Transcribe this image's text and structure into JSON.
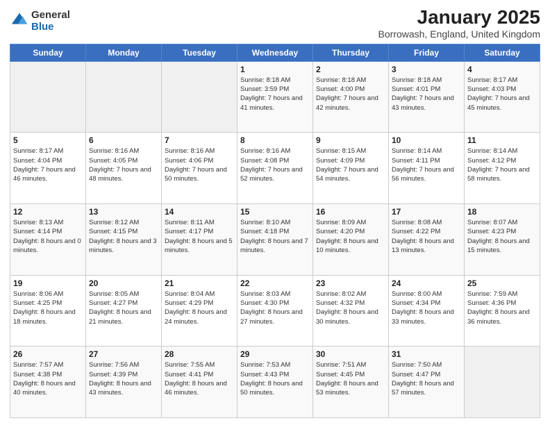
{
  "logo": {
    "general": "General",
    "blue": "Blue"
  },
  "header": {
    "title": "January 2025",
    "location": "Borrowash, England, United Kingdom"
  },
  "weekdays": [
    "Sunday",
    "Monday",
    "Tuesday",
    "Wednesday",
    "Thursday",
    "Friday",
    "Saturday"
  ],
  "weeks": [
    [
      {
        "day": "",
        "sunrise": "",
        "sunset": "",
        "daylight": ""
      },
      {
        "day": "",
        "sunrise": "",
        "sunset": "",
        "daylight": ""
      },
      {
        "day": "",
        "sunrise": "",
        "sunset": "",
        "daylight": ""
      },
      {
        "day": "1",
        "sunrise": "Sunrise: 8:18 AM",
        "sunset": "Sunset: 3:59 PM",
        "daylight": "Daylight: 7 hours and 41 minutes."
      },
      {
        "day": "2",
        "sunrise": "Sunrise: 8:18 AM",
        "sunset": "Sunset: 4:00 PM",
        "daylight": "Daylight: 7 hours and 42 minutes."
      },
      {
        "day": "3",
        "sunrise": "Sunrise: 8:18 AM",
        "sunset": "Sunset: 4:01 PM",
        "daylight": "Daylight: 7 hours and 43 minutes."
      },
      {
        "day": "4",
        "sunrise": "Sunrise: 8:17 AM",
        "sunset": "Sunset: 4:03 PM",
        "daylight": "Daylight: 7 hours and 45 minutes."
      }
    ],
    [
      {
        "day": "5",
        "sunrise": "Sunrise: 8:17 AM",
        "sunset": "Sunset: 4:04 PM",
        "daylight": "Daylight: 7 hours and 46 minutes."
      },
      {
        "day": "6",
        "sunrise": "Sunrise: 8:16 AM",
        "sunset": "Sunset: 4:05 PM",
        "daylight": "Daylight: 7 hours and 48 minutes."
      },
      {
        "day": "7",
        "sunrise": "Sunrise: 8:16 AM",
        "sunset": "Sunset: 4:06 PM",
        "daylight": "Daylight: 7 hours and 50 minutes."
      },
      {
        "day": "8",
        "sunrise": "Sunrise: 8:16 AM",
        "sunset": "Sunset: 4:08 PM",
        "daylight": "Daylight: 7 hours and 52 minutes."
      },
      {
        "day": "9",
        "sunrise": "Sunrise: 8:15 AM",
        "sunset": "Sunset: 4:09 PM",
        "daylight": "Daylight: 7 hours and 54 minutes."
      },
      {
        "day": "10",
        "sunrise": "Sunrise: 8:14 AM",
        "sunset": "Sunset: 4:11 PM",
        "daylight": "Daylight: 7 hours and 56 minutes."
      },
      {
        "day": "11",
        "sunrise": "Sunrise: 8:14 AM",
        "sunset": "Sunset: 4:12 PM",
        "daylight": "Daylight: 7 hours and 58 minutes."
      }
    ],
    [
      {
        "day": "12",
        "sunrise": "Sunrise: 8:13 AM",
        "sunset": "Sunset: 4:14 PM",
        "daylight": "Daylight: 8 hours and 0 minutes."
      },
      {
        "day": "13",
        "sunrise": "Sunrise: 8:12 AM",
        "sunset": "Sunset: 4:15 PM",
        "daylight": "Daylight: 8 hours and 3 minutes."
      },
      {
        "day": "14",
        "sunrise": "Sunrise: 8:11 AM",
        "sunset": "Sunset: 4:17 PM",
        "daylight": "Daylight: 8 hours and 5 minutes."
      },
      {
        "day": "15",
        "sunrise": "Sunrise: 8:10 AM",
        "sunset": "Sunset: 4:18 PM",
        "daylight": "Daylight: 8 hours and 7 minutes."
      },
      {
        "day": "16",
        "sunrise": "Sunrise: 8:09 AM",
        "sunset": "Sunset: 4:20 PM",
        "daylight": "Daylight: 8 hours and 10 minutes."
      },
      {
        "day": "17",
        "sunrise": "Sunrise: 8:08 AM",
        "sunset": "Sunset: 4:22 PM",
        "daylight": "Daylight: 8 hours and 13 minutes."
      },
      {
        "day": "18",
        "sunrise": "Sunrise: 8:07 AM",
        "sunset": "Sunset: 4:23 PM",
        "daylight": "Daylight: 8 hours and 15 minutes."
      }
    ],
    [
      {
        "day": "19",
        "sunrise": "Sunrise: 8:06 AM",
        "sunset": "Sunset: 4:25 PM",
        "daylight": "Daylight: 8 hours and 18 minutes."
      },
      {
        "day": "20",
        "sunrise": "Sunrise: 8:05 AM",
        "sunset": "Sunset: 4:27 PM",
        "daylight": "Daylight: 8 hours and 21 minutes."
      },
      {
        "day": "21",
        "sunrise": "Sunrise: 8:04 AM",
        "sunset": "Sunset: 4:29 PM",
        "daylight": "Daylight: 8 hours and 24 minutes."
      },
      {
        "day": "22",
        "sunrise": "Sunrise: 8:03 AM",
        "sunset": "Sunset: 4:30 PM",
        "daylight": "Daylight: 8 hours and 27 minutes."
      },
      {
        "day": "23",
        "sunrise": "Sunrise: 8:02 AM",
        "sunset": "Sunset: 4:32 PM",
        "daylight": "Daylight: 8 hours and 30 minutes."
      },
      {
        "day": "24",
        "sunrise": "Sunrise: 8:00 AM",
        "sunset": "Sunset: 4:34 PM",
        "daylight": "Daylight: 8 hours and 33 minutes."
      },
      {
        "day": "25",
        "sunrise": "Sunrise: 7:59 AM",
        "sunset": "Sunset: 4:36 PM",
        "daylight": "Daylight: 8 hours and 36 minutes."
      }
    ],
    [
      {
        "day": "26",
        "sunrise": "Sunrise: 7:57 AM",
        "sunset": "Sunset: 4:38 PM",
        "daylight": "Daylight: 8 hours and 40 minutes."
      },
      {
        "day": "27",
        "sunrise": "Sunrise: 7:56 AM",
        "sunset": "Sunset: 4:39 PM",
        "daylight": "Daylight: 8 hours and 43 minutes."
      },
      {
        "day": "28",
        "sunrise": "Sunrise: 7:55 AM",
        "sunset": "Sunset: 4:41 PM",
        "daylight": "Daylight: 8 hours and 46 minutes."
      },
      {
        "day": "29",
        "sunrise": "Sunrise: 7:53 AM",
        "sunset": "Sunset: 4:43 PM",
        "daylight": "Daylight: 8 hours and 50 minutes."
      },
      {
        "day": "30",
        "sunrise": "Sunrise: 7:51 AM",
        "sunset": "Sunset: 4:45 PM",
        "daylight": "Daylight: 8 hours and 53 minutes."
      },
      {
        "day": "31",
        "sunrise": "Sunrise: 7:50 AM",
        "sunset": "Sunset: 4:47 PM",
        "daylight": "Daylight: 8 hours and 57 minutes."
      },
      {
        "day": "",
        "sunrise": "",
        "sunset": "",
        "daylight": ""
      }
    ]
  ]
}
